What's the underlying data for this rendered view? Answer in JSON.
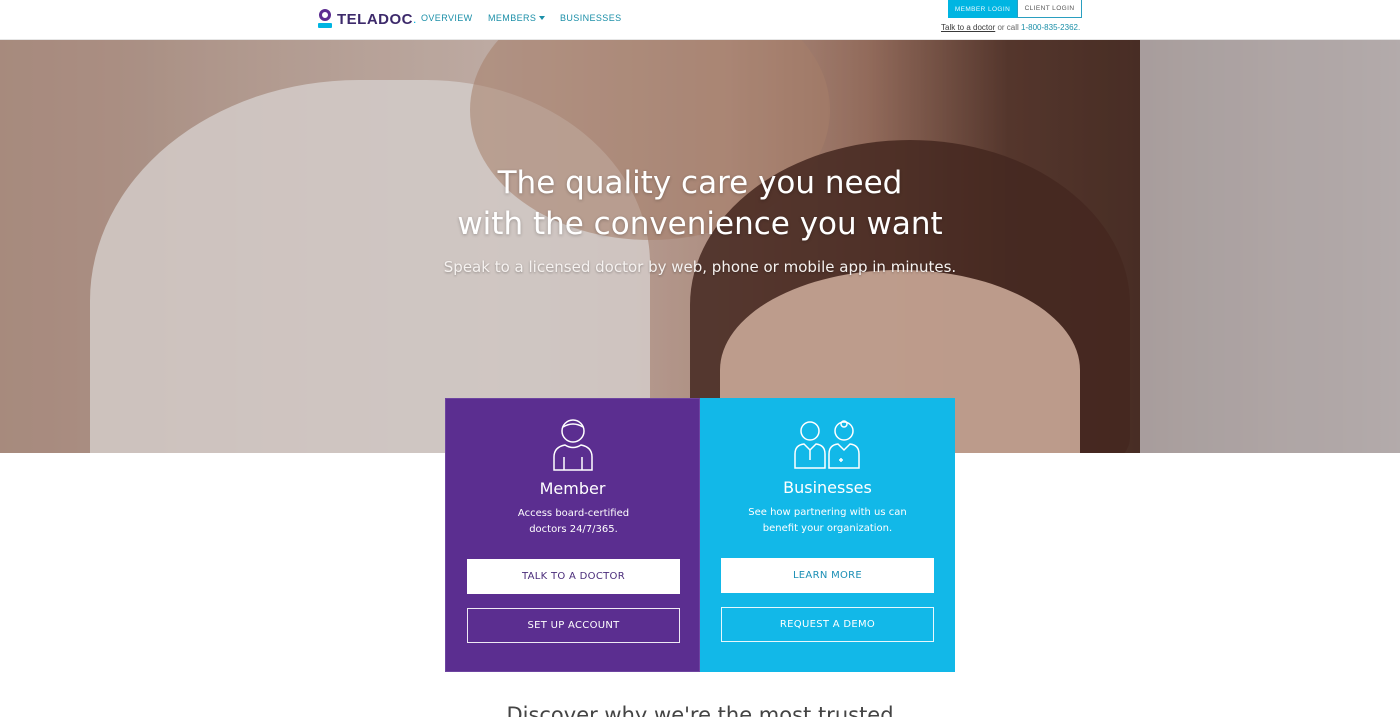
{
  "header": {
    "brand": "TELADOC",
    "nav": [
      {
        "label": "OVERVIEW"
      },
      {
        "label": "MEMBERS"
      },
      {
        "label": "BUSINESSES"
      }
    ],
    "member_login": "MEMBER LOGIN",
    "client_login": "CLIENT LOGIN",
    "talk_link": "Talk to a doctor",
    "contact_mid": " or call ",
    "phone": "1-800-835-2362."
  },
  "hero": {
    "title_line1": "The quality care you need",
    "title_line2": "with the convenience you want",
    "subtitle": "Speak to a licensed doctor by web, phone or mobile app in minutes."
  },
  "cards": {
    "member": {
      "icon": "person-icon",
      "title": "Member",
      "desc_line1": "Access board-certified",
      "desc_line2": "doctors 24/7/365.",
      "primary": "TALK TO A DOCTOR",
      "secondary": "SET UP ACCOUNT",
      "color": "#5b2e90"
    },
    "business": {
      "icon": "doctors-icon",
      "title": "Businesses",
      "desc_line1": "See how partnering with us can",
      "desc_line2": "benefit your organization.",
      "primary": "LEARN MORE",
      "secondary": "REQUEST A DEMO",
      "color": "#12b8e8"
    }
  },
  "teaser": "Discover why we're the most trusted"
}
